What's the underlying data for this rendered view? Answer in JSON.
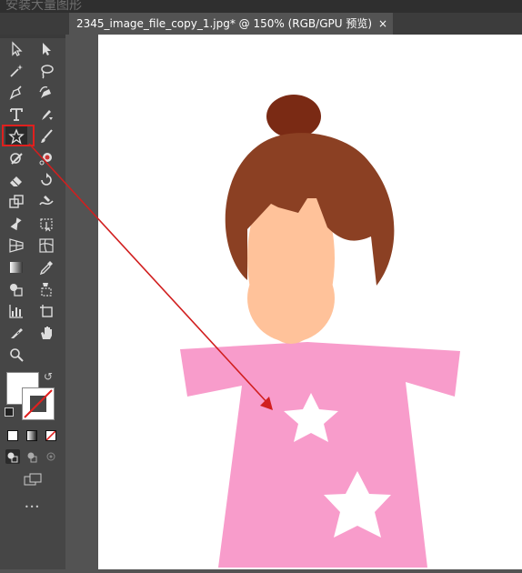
{
  "app": {
    "window_title": "安装大量图形"
  },
  "tab": {
    "label": "2345_image_file_copy_1.jpg* @ 150% (RGB/GPU 预览)",
    "close_glyph": "×"
  },
  "toolbar": {
    "tools": [
      {
        "name": "selection-tool-icon"
      },
      {
        "name": "direct-selection-tool-icon"
      },
      {
        "name": "magic-wand-tool-icon"
      },
      {
        "name": "lasso-tool-icon"
      },
      {
        "name": "pen-tool-icon"
      },
      {
        "name": "curvature-tool-icon"
      },
      {
        "name": "type-tool-icon",
        "glyph": "T"
      },
      {
        "name": "line-segment-tool-icon"
      },
      {
        "name": "star-tool-icon",
        "selected": true
      },
      {
        "name": "paintbrush-tool-icon"
      },
      {
        "name": "shaper-tool-icon"
      },
      {
        "name": "blob-brush-tool-icon"
      },
      {
        "name": "eraser-tool-icon"
      },
      {
        "name": "rotate-tool-icon"
      },
      {
        "name": "scale-tool-icon"
      },
      {
        "name": "warp-tool-icon"
      },
      {
        "name": "puppet-warp-tool-icon"
      },
      {
        "name": "free-transform-tool-icon"
      },
      {
        "name": "perspective-grid-tool-icon"
      },
      {
        "name": "mesh-tool-icon"
      },
      {
        "name": "gradient-tool-icon"
      },
      {
        "name": "eyedropper-tool-icon"
      },
      {
        "name": "shape-builder-tool-icon"
      },
      {
        "name": "live-paint-tool-icon"
      },
      {
        "name": "graph-tool-icon"
      },
      {
        "name": "artboard-tool-icon"
      },
      {
        "name": "slice-tool-icon"
      },
      {
        "name": "hand-tool-icon"
      },
      {
        "name": "zoom-tool-icon"
      }
    ],
    "fill_color": "#ffffff",
    "stroke_color": "none",
    "more_glyph": "•••"
  },
  "annotation": {
    "highlight_color": "#e0201e",
    "arrow_color": "#d11f1f"
  },
  "artwork": {
    "hair_color": "#8b4023",
    "bun_color": "#7a2a14",
    "skin_color": "#ffc29a",
    "dress_color": "#f89ccb",
    "star_color": "#ffffff"
  }
}
